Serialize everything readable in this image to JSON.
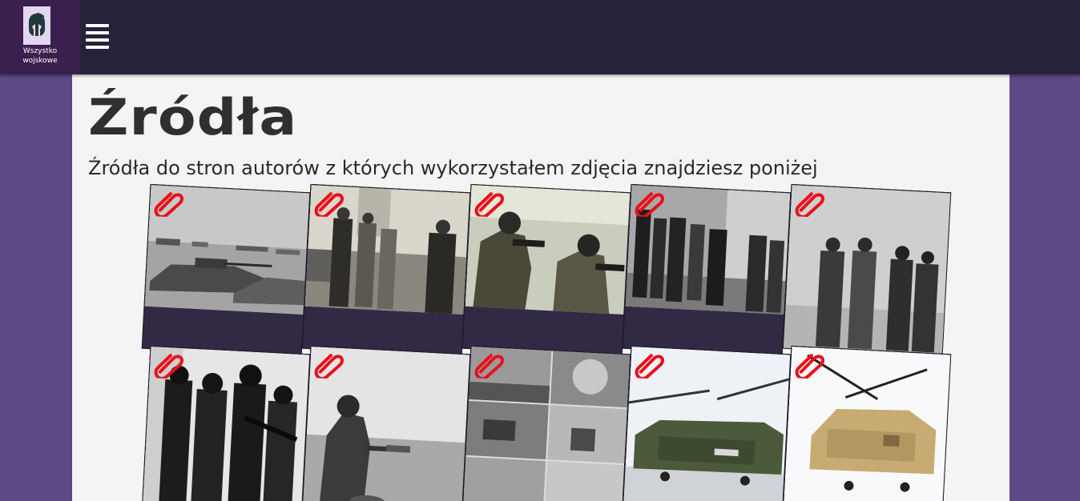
{
  "header": {
    "logo_label_line1": "Wszystko",
    "logo_label_line2": "wojskowe",
    "logo_icon": "spartan-helmet-icon",
    "menu_icon": "hamburger-menu-icon"
  },
  "page": {
    "title": "Źródła",
    "subtitle": "Źródła do stron autorów z których wykorzystałem zdjęcia znajdziesz poniżej"
  },
  "gallery": {
    "link_icon": "paperclip-icon",
    "items": [
      {
        "subject": "tanks-desert"
      },
      {
        "subject": "officers-on-bridge"
      },
      {
        "subject": "soldiers-gas-masks"
      },
      {
        "subject": "officers-street"
      },
      {
        "subject": "officers-snow"
      },
      {
        "subject": "swat-team"
      },
      {
        "subject": "soldier-field"
      },
      {
        "subject": "war-collage"
      },
      {
        "subject": "chinook-green"
      },
      {
        "subject": "chinook-tan"
      }
    ]
  },
  "colors": {
    "topbar": "#26223a",
    "logo_bg": "#3a1f4f",
    "page_bg": "#5b4a86",
    "content_bg": "#f4f4f4",
    "card_bg": "#322a45",
    "clip_red": "#e8101a"
  }
}
